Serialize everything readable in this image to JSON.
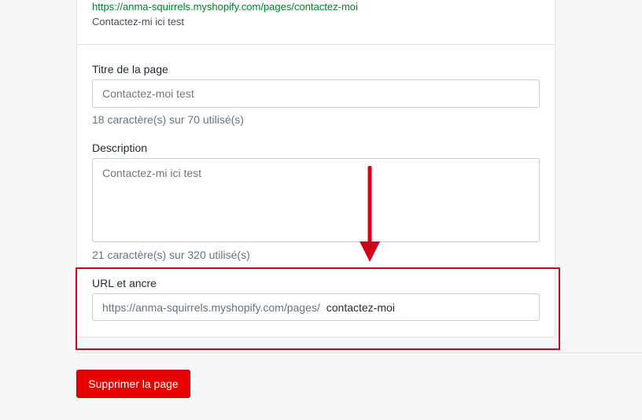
{
  "seo_preview": {
    "url": "https://anma-squirrels.myshopify.com/pages/contactez-moi",
    "description": "Contactez-mi ici test"
  },
  "page_title": {
    "label": "Titre de la page",
    "placeholder": "Contactez-moi test",
    "counter": "18 caractère(s) sur 70 utilisé(s)"
  },
  "description": {
    "label": "Description",
    "placeholder": "Contactez-mi ici test",
    "counter": "21 caractère(s) sur 320 utilisé(s)"
  },
  "url_handle": {
    "label": "URL et ancre",
    "prefix": "https://anma-squirrels.myshopify.com/pages/",
    "value": "contactez-moi"
  },
  "actions": {
    "delete_label": "Supprimer la page"
  },
  "colors": {
    "annotation_red": "#d0021b",
    "delete_button": "#e60000",
    "preview_url_green": "#007f2a"
  }
}
